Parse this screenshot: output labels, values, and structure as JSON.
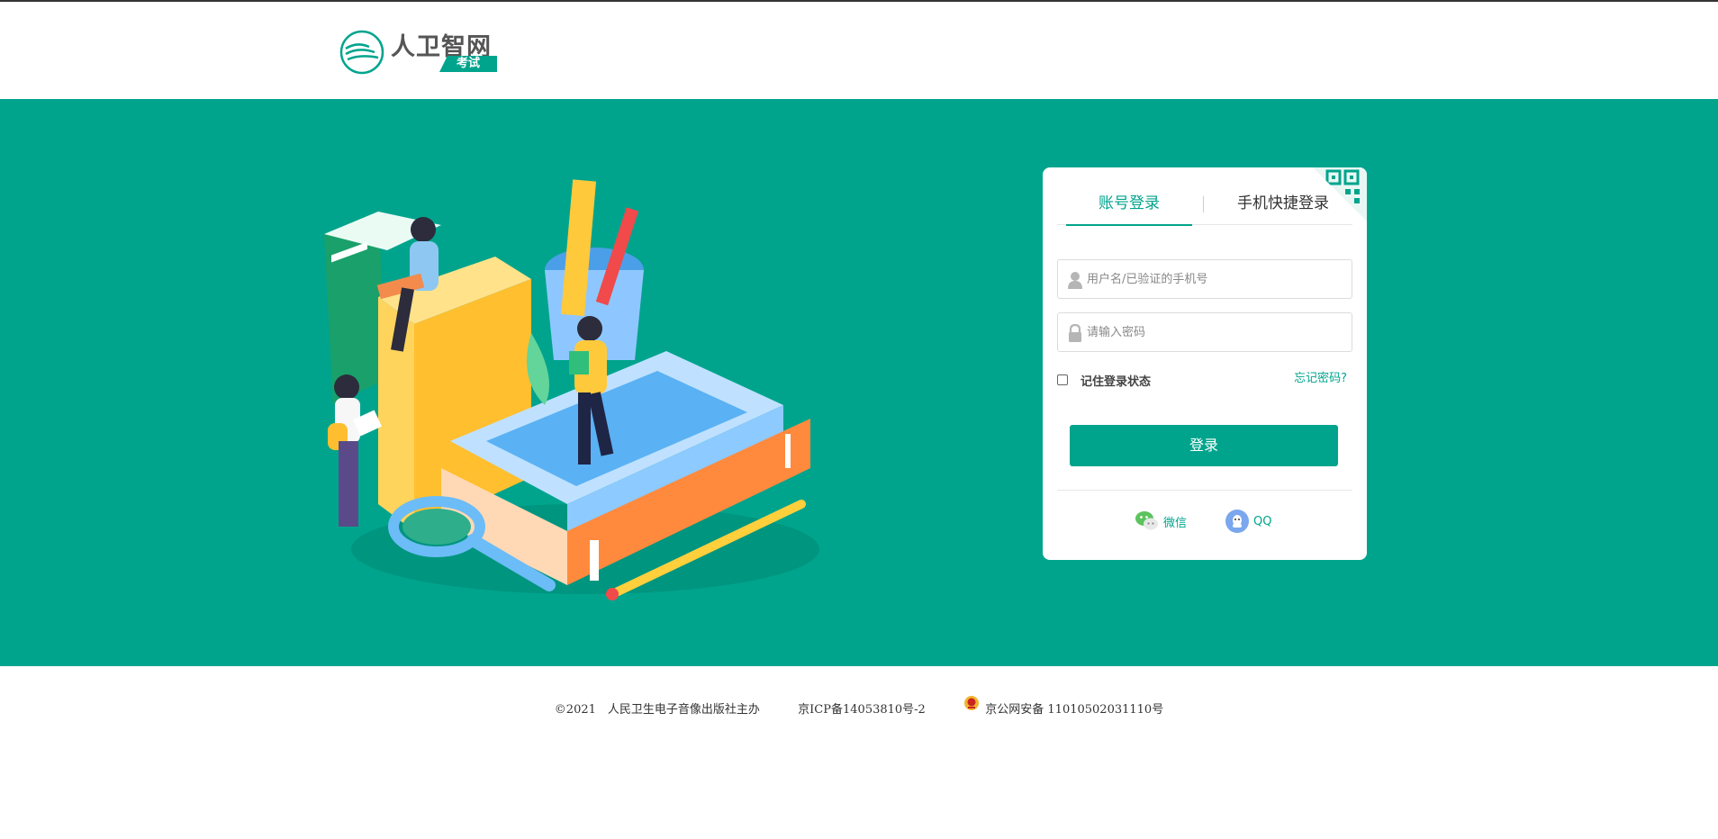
{
  "header": {
    "logo_text": "人卫智网",
    "logo_tag": "考试"
  },
  "login": {
    "tabs": [
      {
        "label": "账号登录",
        "active": true
      },
      {
        "label": "手机快捷登录",
        "active": false
      }
    ],
    "username_placeholder": "用户名/已验证的手机号",
    "password_placeholder": "请输入密码",
    "remember_label": "记住登录状态",
    "remember_checked": false,
    "forgot_label": "忘记密码?",
    "submit_label": "登录",
    "social": [
      {
        "label": "微信",
        "icon": "wechat-icon"
      },
      {
        "label": "QQ",
        "icon": "qq-icon"
      }
    ]
  },
  "footer": {
    "copyright": "©2021　人民卫生电子音像出版社主办",
    "icp": "京ICP备14053810号-2",
    "police": "京公网安备 11010502031110号"
  },
  "colors": {
    "primary": "#00a48d",
    "header_bg": "#ffffff",
    "footer_bg": "#ffffff"
  }
}
